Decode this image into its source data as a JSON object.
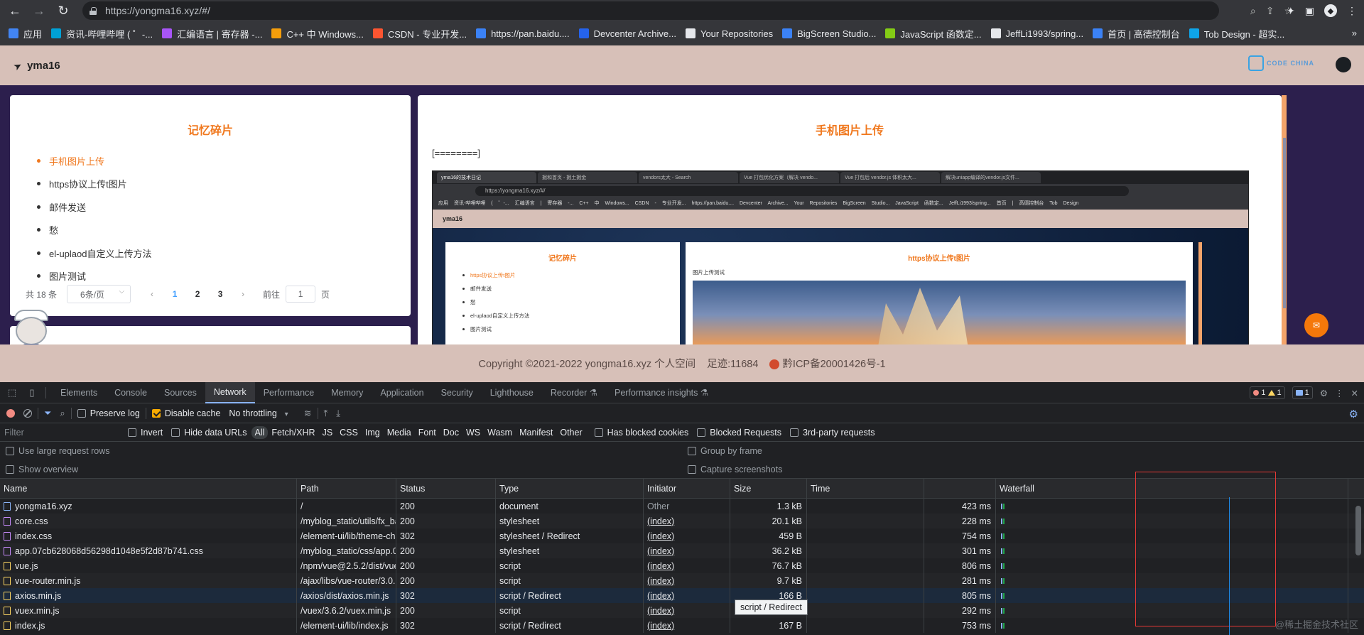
{
  "browser": {
    "url": "https://yongma16.xyz/#/",
    "bookmarks": [
      {
        "label": "应用",
        "color": "#4285f4"
      },
      {
        "label": "资讯-哔哩哔哩 ( ゜-...",
        "color": "#00a1d6"
      },
      {
        "label": "汇编语言 | 寄存器 -...",
        "color": "#a855f7"
      },
      {
        "label": "C++ 中 Windows...",
        "color": "#f59e0b"
      },
      {
        "label": "CSDN - 专业开发...",
        "color": "#fc5531"
      },
      {
        "label": "https://pan.baidu....",
        "color": "#3b82f6"
      },
      {
        "label": "Devcenter Archive...",
        "color": "#2563eb"
      },
      {
        "label": "Your Repositories",
        "color": "#e5e7eb"
      },
      {
        "label": "BigScreen Studio...",
        "color": "#3b82f6"
      },
      {
        "label": "JavaScript 函数定...",
        "color": "#84cc16"
      },
      {
        "label": "JeffLi1993/spring...",
        "color": "#e5e7eb"
      },
      {
        "label": "首页 | 高德控制台",
        "color": "#3b82f6"
      },
      {
        "label": "Tob Design - 超实...",
        "color": "#0ea5e9"
      }
    ]
  },
  "site": {
    "brand": "yma16",
    "codechina": "CODE CHINA",
    "left_title": "记忆碎片",
    "memos": [
      "手机图片上传",
      "https协议上传t图片",
      "邮件发送",
      "愁",
      "el-uplaod自定义上传方法",
      "图片测试"
    ],
    "pager": {
      "total": "共 18 条",
      "size": "6条/页",
      "pages": [
        "1",
        "2",
        "3"
      ],
      "goto_prefix": "前往",
      "goto_value": "1",
      "goto_suffix": "页",
      "prev": "‹",
      "next": "›"
    },
    "right_title": "手机图片上传",
    "md_text": "[========]",
    "footer_copyright": "Copyright ©2021-2022 yongma16.xyz 个人空间",
    "footer_visits": "足迹:11684",
    "footer_icp": "黔ICP备20001426号-1",
    "nested": {
      "tabs": [
        "yma16的技术日记",
        "掘和首页 - 掘土掘金",
        "vendors太大 - Search",
        "Vue 打包优化方案（解决 vendo...",
        "Vue 打包后 vendor.js 体积太大...",
        "解决uniapp编译的vendor.js文件..."
      ],
      "url": "https://yongma16.xyz/#/",
      "bookmarks": "应用 资讯-哔哩哔哩 ( ゜-... 汇编语言 | 寄存器 -... C++ 中 Windows... CSDN - 专业开发... https://pan.baidu.... Devcenter Archive... Your Repositories BigScreen Studio... JavaScript 函数定... JeffLi1993/spring... 首页 | 高德控制台 Tob Design",
      "brand": "yma16",
      "left_title": "记忆碎片",
      "memos": [
        "https协议上传t图片",
        "邮件发送",
        "愁",
        "el-uplaod自定义上传方法",
        "图片测试"
      ],
      "right_title": "https协议上传t图片",
      "right_text": "图片上传测试"
    }
  },
  "devtools": {
    "tabs": [
      "Elements",
      "Console",
      "Sources",
      "Network",
      "Performance",
      "Memory",
      "Application",
      "Security",
      "Lighthouse",
      "Recorder ⚗",
      "Performance insights ⚗"
    ],
    "active_tab": "Network",
    "errors": "1",
    "warnings": "1",
    "messages": "1",
    "preserve_log": "Preserve log",
    "disable_cache": "Disable cache",
    "throttling": "No throttling",
    "filter_placeholder": "Filter",
    "invert": "Invert",
    "hide_data_urls": "Hide data URLs",
    "types": [
      "All",
      "Fetch/XHR",
      "JS",
      "CSS",
      "Img",
      "Media",
      "Font",
      "Doc",
      "WS",
      "Wasm",
      "Manifest",
      "Other"
    ],
    "has_blocked_cookies": "Has blocked cookies",
    "blocked_requests": "Blocked Requests",
    "third_party": "3rd-party requests",
    "large_rows": "Use large request rows",
    "group_by_frame": "Group by frame",
    "show_overview": "Show overview",
    "capture_screenshots": "Capture screenshots",
    "columns": [
      "Name",
      "Path",
      "Status",
      "Type",
      "Initiator",
      "Size",
      "Time",
      "",
      "Waterfall"
    ],
    "rows": [
      {
        "name": "yongma16.xyz",
        "path": "/",
        "status": "200",
        "type": "document",
        "initiator": "Other",
        "size": "1.3 kB",
        "time": "423 ms",
        "color": "#8ab4f8"
      },
      {
        "name": "core.css",
        "path": "/myblog_static/utils/fx_back...",
        "status": "200",
        "type": "stylesheet",
        "initiator": "(index)",
        "size": "20.1 kB",
        "time": "228 ms",
        "color": "#c58af9"
      },
      {
        "name": "index.css",
        "path": "/element-ui/lib/theme-chalk...",
        "status": "302",
        "type": "stylesheet / Redirect",
        "initiator": "(index)",
        "size": "459 B",
        "time": "754 ms",
        "color": "#c58af9"
      },
      {
        "name": "app.07cb628068d56298d1048e5f2d87b741.css",
        "path": "/myblog_static/css/app.07cb...",
        "status": "200",
        "type": "stylesheet",
        "initiator": "(index)",
        "size": "36.2 kB",
        "time": "301 ms",
        "color": "#c58af9"
      },
      {
        "name": "vue.js",
        "path": "/npm/vue@2.5.2/dist/vue.js",
        "status": "200",
        "type": "script",
        "initiator": "(index)",
        "size": "76.7 kB",
        "time": "806 ms",
        "color": "#fdd663"
      },
      {
        "name": "vue-router.min.js",
        "path": "/ajax/libs/vue-router/3.0.1/v...",
        "status": "200",
        "type": "script",
        "initiator": "(index)",
        "size": "9.7 kB",
        "time": "281 ms",
        "color": "#fdd663"
      },
      {
        "name": "axios.min.js",
        "path": "/axios/dist/axios.min.js",
        "status": "302",
        "type": "script / Redirect",
        "initiator": "(index)",
        "size": "166 B",
        "time": "805 ms",
        "color": "#fdd663"
      },
      {
        "name": "vuex.min.js",
        "path": "/vuex/3.6.2/vuex.min.js",
        "status": "200",
        "type": "script",
        "initiator": "(index)",
        "size": "4.8 kB",
        "time": "292 ms",
        "color": "#fdd663"
      },
      {
        "name": "index.js",
        "path": "/element-ui/lib/index.js",
        "status": "302",
        "type": "script / Redirect",
        "initiator": "(index)",
        "size": "167 B",
        "time": "753 ms",
        "color": "#fdd663"
      }
    ],
    "tooltip": "script / Redirect",
    "watermark": "@稀土掘金技术社区"
  }
}
